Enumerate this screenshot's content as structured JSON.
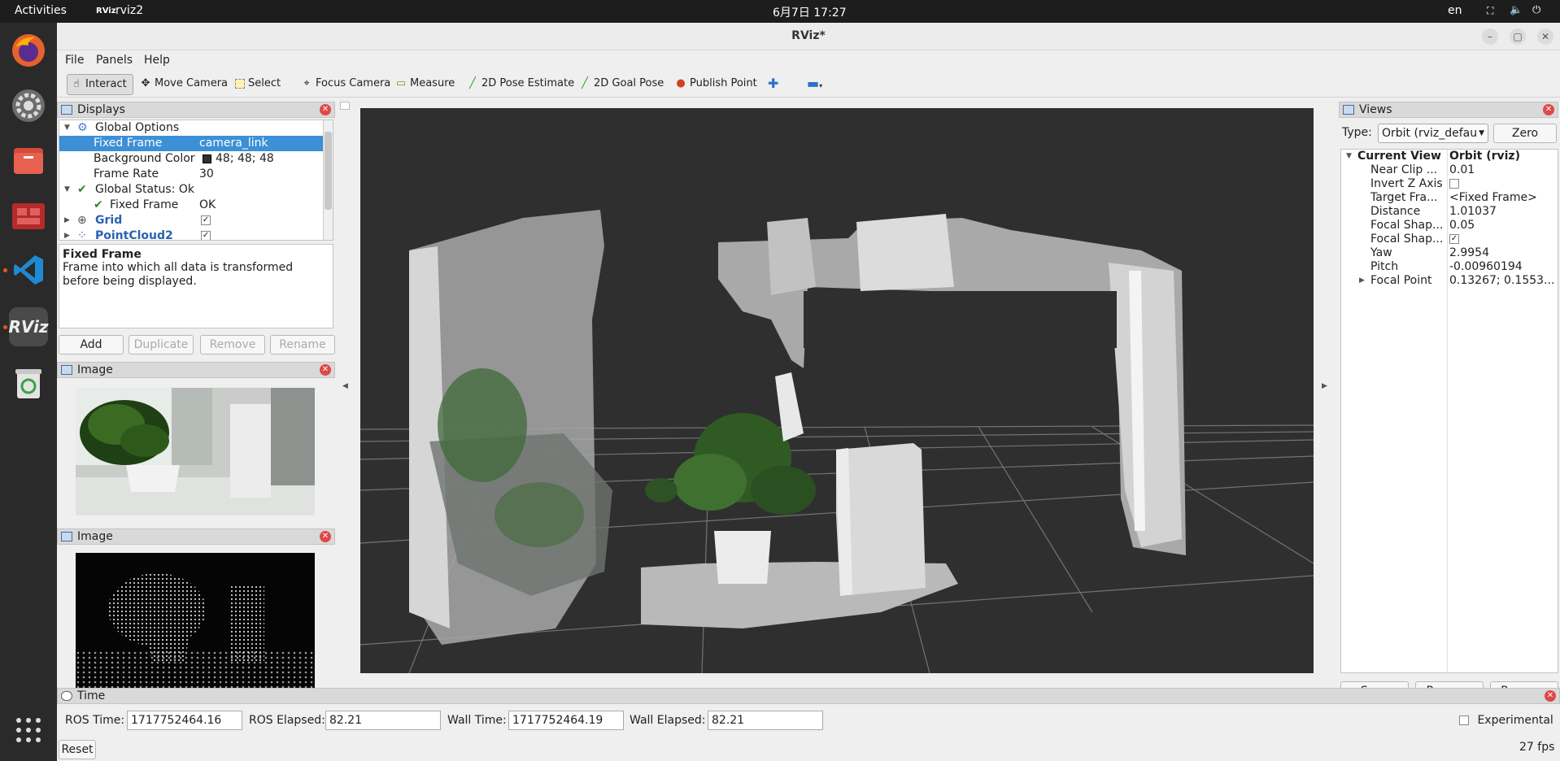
{
  "topbar": {
    "activities": "Activities",
    "app_name": "rviz2",
    "clock": "6月7日  17:27",
    "lang": "en"
  },
  "window": {
    "title": "RViz*"
  },
  "menu": {
    "file": "File",
    "panels": "Panels",
    "help": "Help"
  },
  "toolbar": {
    "interact": "Interact",
    "move_camera": "Move Camera",
    "select": "Select",
    "focus_camera": "Focus Camera",
    "measure": "Measure",
    "pose_estimate": "2D Pose Estimate",
    "goal_pose": "2D Goal Pose",
    "publish_point": "Publish Point"
  },
  "displays": {
    "title": "Displays",
    "rows": [
      {
        "label": "Global Options",
        "value": ""
      },
      {
        "label": "Fixed Frame",
        "value": "camera_link"
      },
      {
        "label": "Background Color",
        "value": "48; 48; 48"
      },
      {
        "label": "Frame Rate",
        "value": "30"
      },
      {
        "label": "Global Status: Ok",
        "value": ""
      },
      {
        "label": "Fixed Frame",
        "value": "OK"
      },
      {
        "label": "Grid",
        "value": ""
      },
      {
        "label": "PointCloud2",
        "value": ""
      }
    ],
    "grid_enabled": true,
    "pointcloud_enabled": true,
    "background_color": "#303030",
    "description_title": "Fixed Frame",
    "description": "Frame into which all data is transformed before being displayed.",
    "buttons": {
      "add": "Add",
      "duplicate": "Duplicate",
      "remove": "Remove",
      "rename": "Rename"
    }
  },
  "image1": {
    "title": "Image"
  },
  "image2": {
    "title": "Image"
  },
  "views": {
    "title": "Views",
    "type_label": "Type:",
    "type_value": "Orbit (rviz_defau",
    "zero": "Zero",
    "rows": [
      {
        "label": "Current View",
        "value": "Orbit (rviz)"
      },
      {
        "label": "Near Clip ...",
        "value": "0.01"
      },
      {
        "label": "Invert Z Axis",
        "value": ""
      },
      {
        "label": "Target Fra...",
        "value": "<Fixed Frame>"
      },
      {
        "label": "Distance",
        "value": "1.01037"
      },
      {
        "label": "Focal Shap...",
        "value": "0.05"
      },
      {
        "label": "Focal Shap...",
        "value": ""
      },
      {
        "label": "Yaw",
        "value": "2.9954"
      },
      {
        "label": "Pitch",
        "value": "-0.00960194"
      },
      {
        "label": "Focal Point",
        "value": "0.13267; 0.1553..."
      }
    ],
    "invert_z": false,
    "focal_shape_fixed": true,
    "buttons": {
      "save": "Save",
      "remove": "Remove",
      "rename": "Rename"
    }
  },
  "time": {
    "title": "Time",
    "ros_time_label": "ROS Time:",
    "ros_time": "1717752464.16",
    "ros_elapsed_label": "ROS Elapsed:",
    "ros_elapsed": "82.21",
    "wall_time_label": "Wall Time:",
    "wall_time": "1717752464.19",
    "wall_elapsed_label": "Wall Elapsed:",
    "wall_elapsed": "82.21",
    "experimental": "Experimental",
    "reset": "Reset",
    "fps": "27 fps"
  }
}
